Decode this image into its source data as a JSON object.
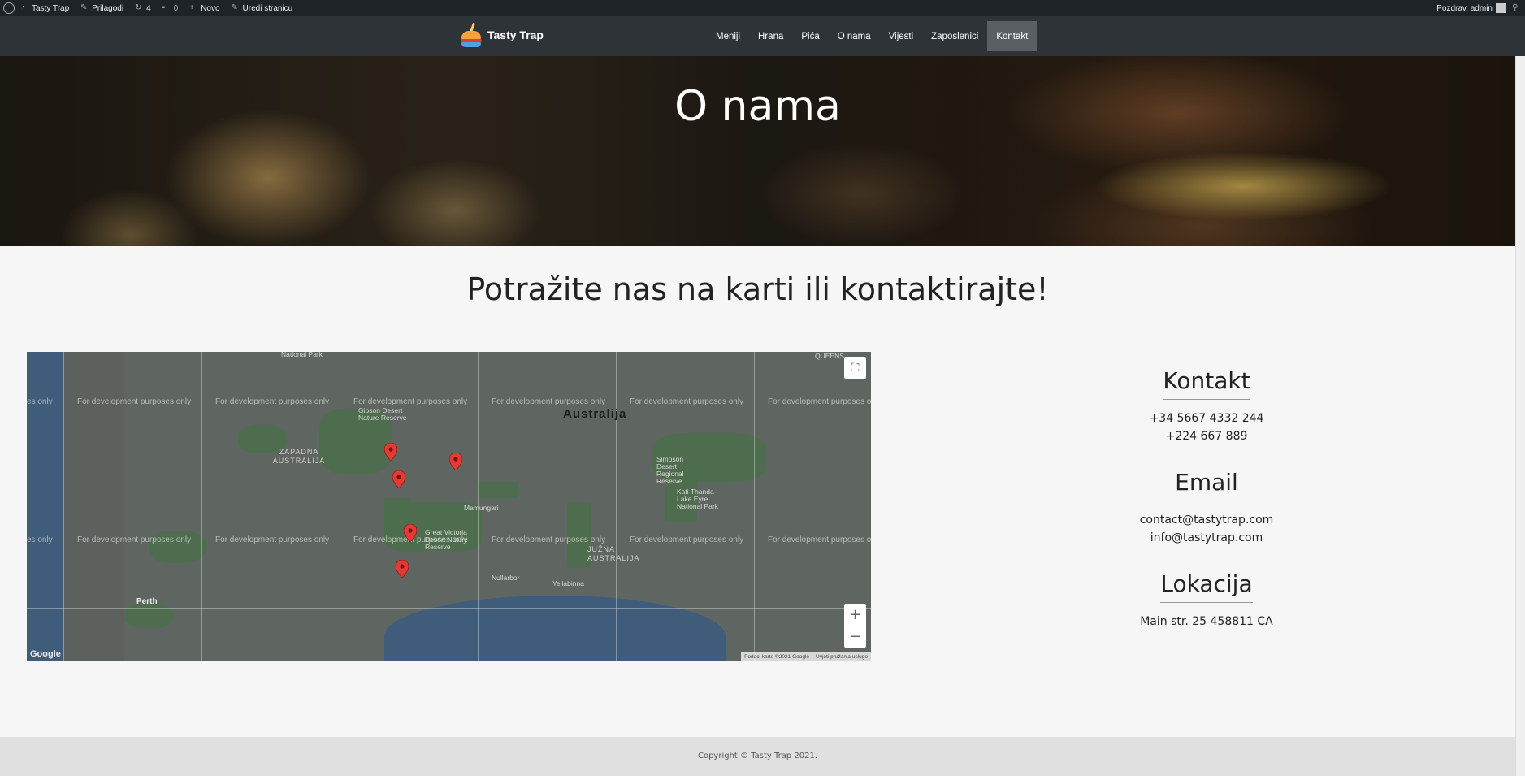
{
  "adminbar": {
    "site_name": "Tasty Trap",
    "customize": "Prilagodi",
    "updates_count": "4",
    "comments_count": "0",
    "new_label": "Novo",
    "edit_page": "Uredi stranicu",
    "greeting": "Pozdrav, admin"
  },
  "nav": {
    "brand": "Tasty Trap",
    "items": [
      "Meniji",
      "Hrana",
      "Pića",
      "O nama",
      "Vijesti",
      "Zaposlenici",
      "Kontakt"
    ],
    "active": "Kontakt"
  },
  "hero": {
    "title": "O nama"
  },
  "subtitle": "Potražite nas na karti ili kontaktirajte!",
  "map": {
    "watermark": "For development purposes only",
    "watermark_cut": "es only",
    "watermark_cut_right": "For development purposes o",
    "country": "Australija",
    "region_west": "ZAPADNA AUSTRALIJA",
    "region_south": "JUŽNA AUSTRALIJA",
    "places": {
      "national_park": "National Park",
      "gibson": "Gibson Desert Nature Reserve",
      "simpson": "Simpson Desert Regional Reserve",
      "kati": "Kati Thanda-Lake Eyre National Park",
      "great_victoria": "Great Victoria Desert Nature Reserve",
      "mamungari": "Mamungari",
      "nullarbor": "Nullarbor",
      "yellabinna": "Yellabinna",
      "perth": "Perth",
      "queens": "QUEENS"
    },
    "google": "Google",
    "attribution": "Podaci karte ©2021 Google",
    "terms": "Uvjeti pružanja usluge",
    "zoom_in": "+",
    "zoom_out": "−",
    "pins": 5
  },
  "contact": {
    "heading": "Kontakt",
    "phone1": "+34 5667 4332 244",
    "phone2": "+224 667 889",
    "email_heading": "Email",
    "email1": "contact@tastytrap.com",
    "email2": "info@tastytrap.com",
    "location_heading": "Lokacija",
    "address": "Main str. 25 458811 CA"
  },
  "footer": {
    "copyright": "Copyright © Tasty Trap 2021."
  },
  "colors": {
    "navbar": "#2e3338",
    "adminbar": "#1d2327",
    "active_menu": "#5a5f64",
    "pin": "#e53935"
  }
}
